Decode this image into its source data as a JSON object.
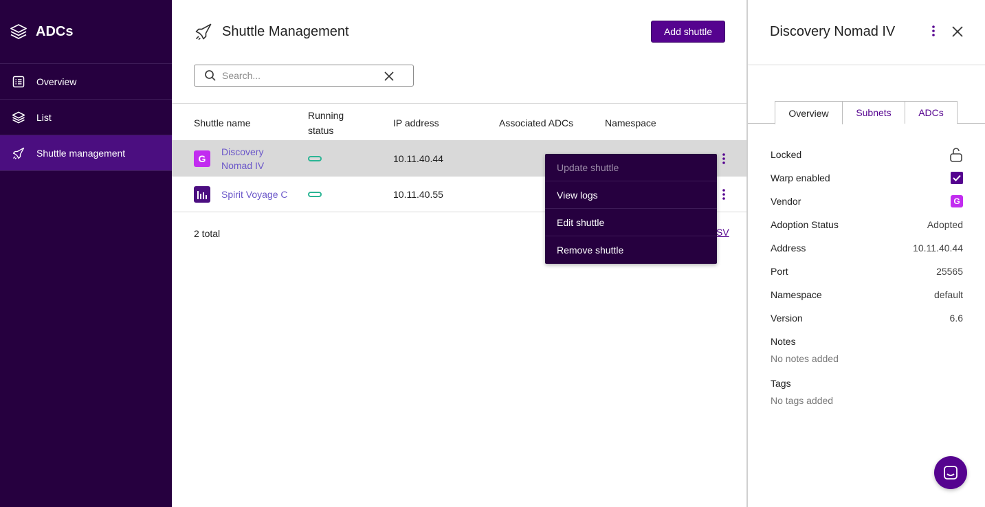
{
  "sidebar": {
    "brand": "ADCs",
    "items": [
      {
        "label": "Overview",
        "icon": "list-alt-icon"
      },
      {
        "label": "List",
        "icon": "layers-icon"
      },
      {
        "label": "Shuttle management",
        "icon": "rocket-icon",
        "active": true
      }
    ]
  },
  "header": {
    "title": "Shuttle Management",
    "add_button": "Add shuttle"
  },
  "search": {
    "placeholder": "Search...",
    "value": ""
  },
  "table": {
    "columns": [
      "Shuttle name",
      "Running status",
      "IP address",
      "Associated ADCs",
      "Namespace"
    ],
    "rows": [
      {
        "name_line1": "Discovery",
        "name_line2": "Nomad IV",
        "badge": "G",
        "badge_color": "#c22cf0",
        "ip": "10.11.40.44",
        "selected": true
      },
      {
        "name_line1": "Spirit Voyage C",
        "name_line2": "",
        "badge": "bars",
        "badge_color": "#4b0e80",
        "ip": "10.11.40.55",
        "selected": false
      }
    ],
    "total": "2 total",
    "csv_fragment": "SV"
  },
  "menu": {
    "items": [
      {
        "label": "Update shuttle",
        "disabled": true
      },
      {
        "label": "View logs",
        "disabled": false
      },
      {
        "label": "Edit shuttle",
        "disabled": false
      },
      {
        "label": "Remove shuttle",
        "disabled": false
      }
    ]
  },
  "panel": {
    "title": "Discovery Nomad IV",
    "tabs": [
      "Overview",
      "Subnets",
      "ADCs"
    ],
    "props": [
      {
        "label": "Locked",
        "value": ""
      },
      {
        "label": "Warp enabled",
        "value": ""
      },
      {
        "label": "Vendor",
        "value": "G"
      },
      {
        "label": "Adoption Status",
        "value": "Adopted"
      },
      {
        "label": "Address",
        "value": "10.11.40.44"
      },
      {
        "label": "Port",
        "value": "25565"
      },
      {
        "label": "Namespace",
        "value": "default"
      },
      {
        "label": "Version",
        "value": "6.6"
      }
    ],
    "notes_label": "Notes",
    "notes_value": "No notes added",
    "tags_label": "Tags",
    "tags_value": "No tags added"
  },
  "colors": {
    "sidebar_bg": "#26003f",
    "accent": "#55038f",
    "status_green": "#2bb594",
    "vendor_pink": "#c22cf0"
  }
}
